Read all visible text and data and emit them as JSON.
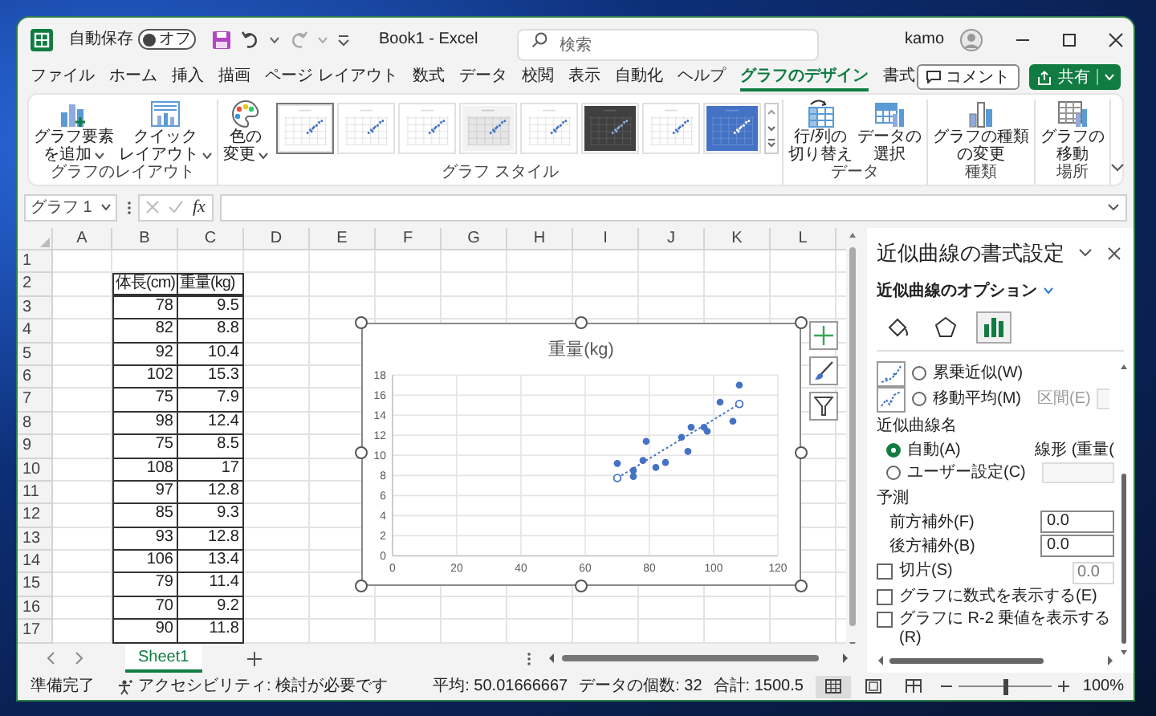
{
  "title_bar": {
    "autosave_label": "自動保存",
    "autosave_toggle": {
      "label": "オフ",
      "on": false
    },
    "title": "Book1 - Excel",
    "search_placeholder": "検索",
    "user_name": "kamo"
  },
  "menu_tabs": [
    {
      "label": "ファイル",
      "selected": false
    },
    {
      "label": "ホーム",
      "selected": false
    },
    {
      "label": "挿入",
      "selected": false
    },
    {
      "label": "描画",
      "selected": false
    },
    {
      "label": "ページ レイアウト",
      "selected": false
    },
    {
      "label": "数式",
      "selected": false
    },
    {
      "label": "データ",
      "selected": false
    },
    {
      "label": "校閲",
      "selected": false
    },
    {
      "label": "表示",
      "selected": false
    },
    {
      "label": "自動化",
      "selected": false
    },
    {
      "label": "ヘルプ",
      "selected": false
    },
    {
      "label": "グラフのデザイン",
      "selected": true
    },
    {
      "label": "書式",
      "selected": false
    }
  ],
  "comment_button": "コメント",
  "share_button": "共有",
  "ribbon_groups": [
    {
      "label": "グラフのレイアウト",
      "buttons": [
        {
          "kind": "add-element",
          "lines": [
            "グラフ要素",
            "を追加"
          ],
          "dropdown": true
        },
        {
          "kind": "quick-layout",
          "lines": [
            "クイック",
            "レイアウト"
          ],
          "dropdown": true
        }
      ]
    },
    {
      "label": "グラフ スタイル",
      "buttons": [
        {
          "kind": "palette",
          "lines": [
            "色の",
            "変更"
          ],
          "dropdown": true
        }
      ],
      "gallery": [
        {
          "kind": "white",
          "selected": true
        },
        {
          "kind": "white",
          "selected": false
        },
        {
          "kind": "white",
          "selected": false
        },
        {
          "kind": "gray",
          "selected": false
        },
        {
          "kind": "white",
          "selected": false
        },
        {
          "kind": "dark",
          "selected": false
        },
        {
          "kind": "white",
          "selected": false
        },
        {
          "kind": "blue",
          "selected": false
        }
      ]
    },
    {
      "label": "データ",
      "buttons": [
        {
          "kind": "switch",
          "lines": [
            "行/列の",
            "切り替え"
          ],
          "dropdown": false
        },
        {
          "kind": "select-data",
          "lines": [
            "データの",
            "選択"
          ],
          "dropdown": false
        }
      ]
    },
    {
      "label": "種類",
      "buttons": [
        {
          "kind": "chart-type",
          "lines": [
            "グラフの種類",
            "の変更"
          ],
          "dropdown": false
        }
      ]
    },
    {
      "label": "場所",
      "buttons": [
        {
          "kind": "move",
          "lines": [
            "グラフの",
            "移動"
          ],
          "dropdown": false
        }
      ]
    }
  ],
  "formula_bar": {
    "name_box": "グラフ 1",
    "function_button": "fx"
  },
  "sheet": {
    "columns": [
      "A",
      "B",
      "C",
      "D",
      "E",
      "F",
      "G",
      "H",
      "I",
      "J",
      "K",
      "L"
    ],
    "rows": [
      "1",
      "2",
      "3",
      "4",
      "5",
      "6",
      "7",
      "8",
      "9",
      "10",
      "11",
      "12",
      "13",
      "14",
      "15",
      "16",
      "17"
    ],
    "table": {
      "header": [
        "体長(cm)",
        "重量(kg)"
      ],
      "rows": [
        [
          "78",
          "9.5"
        ],
        [
          "82",
          "8.8"
        ],
        [
          "92",
          "10.4"
        ],
        [
          "102",
          "15.3"
        ],
        [
          "75",
          "7.9"
        ],
        [
          "98",
          "12.4"
        ],
        [
          "75",
          "8.5"
        ],
        [
          "108",
          "17"
        ],
        [
          "97",
          "12.8"
        ],
        [
          "85",
          "9.3"
        ],
        [
          "93",
          "12.8"
        ],
        [
          "106",
          "13.4"
        ],
        [
          "79",
          "11.4"
        ],
        [
          "70",
          "9.2"
        ],
        [
          "90",
          "11.8"
        ]
      ]
    },
    "chart": {
      "selected": true,
      "chart_data": {
        "type": "scatter",
        "title": "重量(kg)",
        "x": [
          78,
          82,
          92,
          102,
          75,
          98,
          75,
          108,
          97,
          85,
          93,
          106,
          79,
          70,
          90
        ],
        "series": [
          {
            "color": "#4472c4",
            "values": [
              9.5,
              8.8,
              10.4,
              15.3,
              7.9,
              12.4,
              8.5,
              17,
              12.8,
              9.3,
              12.8,
              13.4,
              11.4,
              9.2,
              11.8
            ]
          }
        ],
        "xlim": [
          0,
          120
        ],
        "ylim": [
          0,
          18
        ],
        "xticks": [
          0,
          20,
          40,
          60,
          80,
          100,
          120
        ],
        "yticks": [
          0,
          2,
          4,
          6,
          8,
          10,
          12,
          14,
          16,
          18
        ],
        "grid": true
      },
      "trendline": {
        "kind": "linear",
        "selected": true
      }
    },
    "tabs": [
      {
        "label": "Sheet1",
        "selected": true
      }
    ]
  },
  "format_pane": {
    "title": "近似曲線の書式設定",
    "subtitle": "近似曲線のオプション",
    "tabs": [
      {
        "kind": "fill",
        "selected": false
      },
      {
        "kind": "effects",
        "selected": false
      },
      {
        "kind": "options",
        "selected": true
      }
    ],
    "trend_types": [
      {
        "kind": "power",
        "label": "累乗近似(W)",
        "selected": false
      },
      {
        "kind": "moving-average",
        "label": "移動平均(M)",
        "selected": false,
        "period_label": "区間(E)"
      }
    ],
    "name_heading": "近似曲線名",
    "name_options": [
      {
        "kind": "auto",
        "label": "自動(A)",
        "selected": true,
        "value": "線形 (重量("
      },
      {
        "kind": "custom",
        "label": "ユーザー設定(C)",
        "selected": false
      }
    ],
    "forecast_heading": "予測",
    "forecast_fields": [
      {
        "label": "前方補外(F)",
        "value": "0.0"
      },
      {
        "label": "後方補外(B)",
        "value": "0.0"
      }
    ],
    "checkboxes": [
      {
        "label": "切片(S)",
        "checked": false,
        "value": "0.0",
        "field_disabled": true
      },
      {
        "label": "グラフに数式を表示する(E)",
        "checked": false
      },
      {
        "label": "グラフに R-2 乗値を表示する(R)",
        "checked": false
      }
    ]
  },
  "status_bar": {
    "mode": "準備完了",
    "accessibility": "アクセシビリティ: 検討が必要です",
    "average": "平均: 50.01666667",
    "count": "データの個数: 32",
    "sum": "合計: 1500.5",
    "views": [
      {
        "kind": "normal",
        "selected": true
      },
      {
        "kind": "page-layout",
        "selected": false
      },
      {
        "kind": "page-break",
        "selected": false
      }
    ],
    "zoom": {
      "level": 0.5,
      "label": "100%"
    }
  }
}
